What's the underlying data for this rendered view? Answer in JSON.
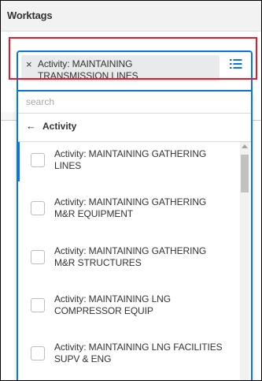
{
  "header": {
    "title": "Worktags"
  },
  "selected_pill": {
    "remove_glyph": "×",
    "label": "Activity: MAINTAINING TRANSMISSION LINES"
  },
  "search": {
    "placeholder": "search",
    "value": ""
  },
  "back_row": {
    "arrow_glyph": "←",
    "label": "Activity"
  },
  "list": {
    "items": [
      {
        "label": "Activity: MAINTAINING GATHERING LINES",
        "checked": false
      },
      {
        "label": "Activity: MAINTAINING GATHERING M&R EQUIPMENT",
        "checked": false
      },
      {
        "label": "Activity: MAINTAINING GATHERING M&R STRUCTURES",
        "checked": false
      },
      {
        "label": "Activity: MAINTAINING LNG COMPRESSOR EQUIP",
        "checked": false
      },
      {
        "label": "Activity: MAINTAINING LNG FACILITIES SUPV & ENG",
        "checked": false
      }
    ]
  },
  "icons": {
    "prompt": "prompt-list-icon",
    "remove": "close-icon",
    "back": "arrow-left-icon"
  },
  "colors": {
    "accent": "#0875e1",
    "highlight": "#e8192c",
    "pill_background": "#e9eaeb",
    "header_background": "#f2f2f2"
  }
}
